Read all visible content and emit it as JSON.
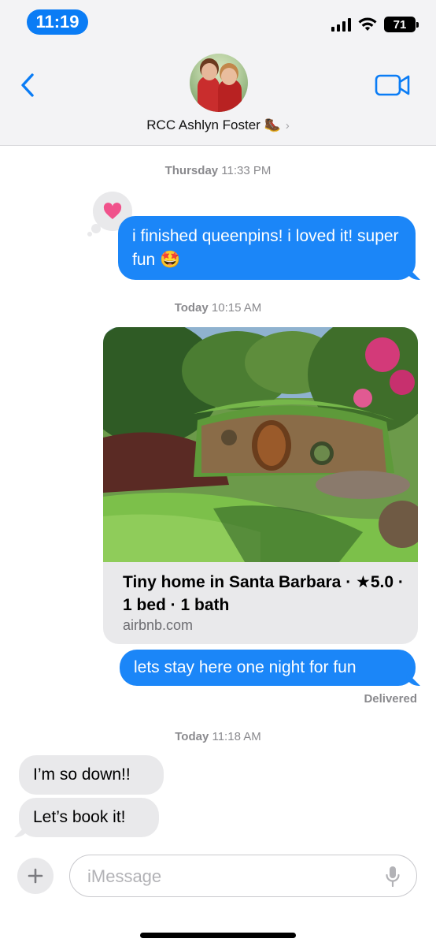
{
  "status_bar": {
    "time": "11:19",
    "battery": "71"
  },
  "header": {
    "contact_name": "RCC Ashlyn Foster 🥾"
  },
  "messages": {
    "ts1": {
      "day": "Thursday",
      "time": "11:33 PM"
    },
    "msg1": {
      "text": "i finished queenpins! i loved it! super fun 🤩",
      "reaction": "heart"
    },
    "ts2": {
      "day": "Today",
      "time": "10:15 AM"
    },
    "link": {
      "title": "Tiny home in Santa Barbara · ★5.0 · 1 bed · 1 bath",
      "domain": "airbnb.com"
    },
    "msg2": {
      "text": "lets stay here one night for fun"
    },
    "delivered": "Delivered",
    "ts3": {
      "day": "Today",
      "time": "11:18 AM"
    },
    "msg3": {
      "text": "I’m so down!!"
    },
    "msg4": {
      "text": "Let’s book it!"
    }
  },
  "compose": {
    "placeholder": "iMessage"
  },
  "colors": {
    "accent": "#0a7cf5",
    "outgoing_bubble": "#1b86f8",
    "incoming_bubble": "#e9e9eb",
    "reaction": "#f0528b"
  },
  "icons": [
    "back-chevron-icon",
    "video-camera-icon",
    "chevron-right-icon",
    "heart-icon",
    "plus-icon",
    "microphone-icon",
    "signal-icon",
    "wifi-icon",
    "battery-icon"
  ]
}
